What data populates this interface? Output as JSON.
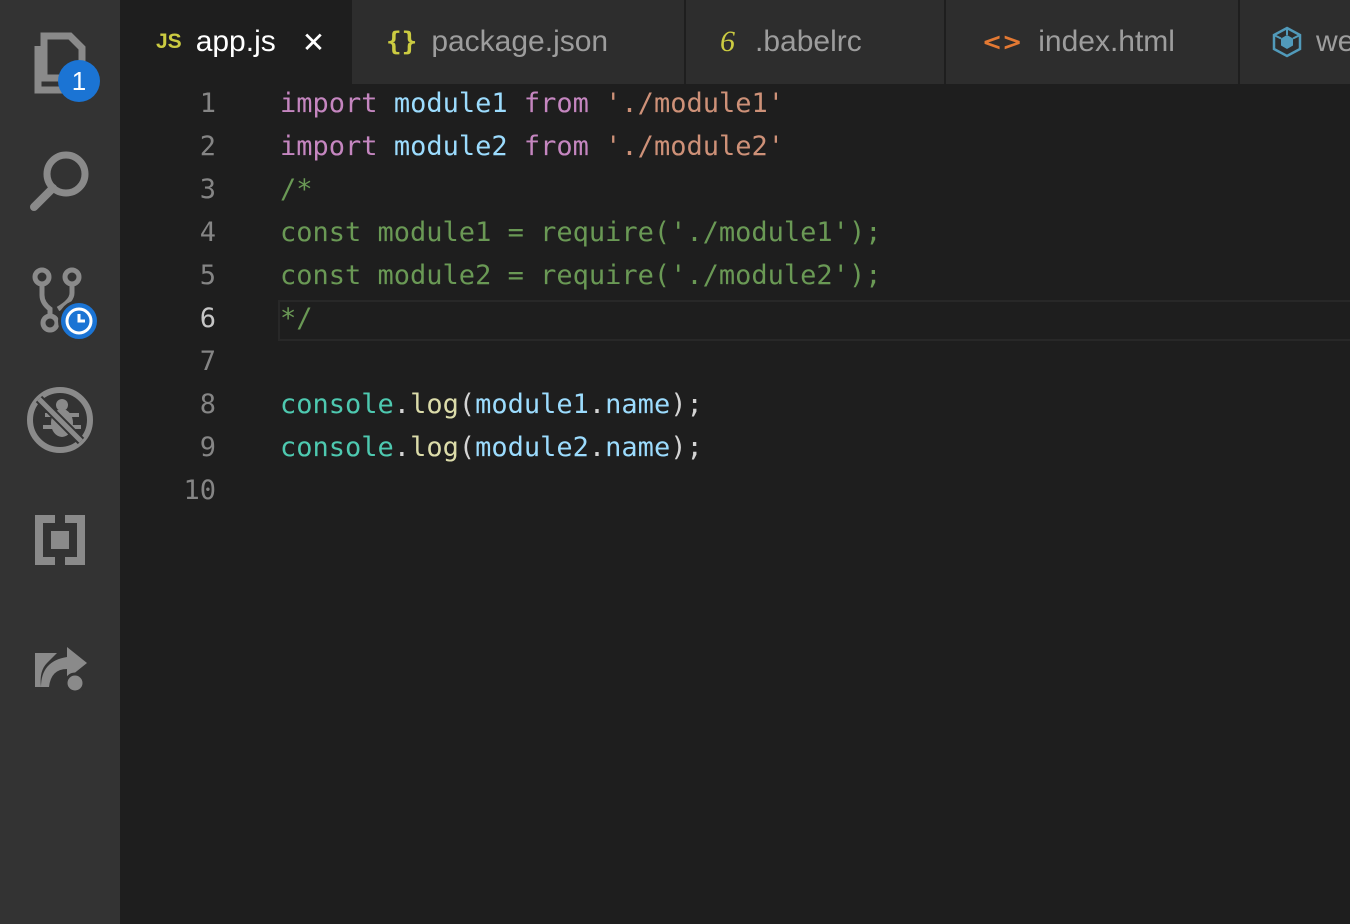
{
  "activity_bar": {
    "explorer_badge": "1",
    "items": [
      "explorer",
      "search",
      "source-control",
      "debug",
      "extensions",
      "live-share"
    ]
  },
  "tabs": [
    {
      "icon": "JS",
      "label": "app.js",
      "active": true,
      "close": "✕"
    },
    {
      "icon": "{}",
      "label": "package.json",
      "active": false
    },
    {
      "icon": "6",
      "label": ".babelrc",
      "active": false
    },
    {
      "icon": "<>",
      "label": "index.html",
      "active": false
    },
    {
      "icon": "webpack-cube-icon",
      "label": "we",
      "active": false
    }
  ],
  "editor": {
    "current_line": 6,
    "lines": [
      {
        "n": "1",
        "tokens": [
          [
            "kw",
            "import"
          ],
          [
            "pl",
            " "
          ],
          [
            "id",
            "module1"
          ],
          [
            "pl",
            " "
          ],
          [
            "kw",
            "from"
          ],
          [
            "pl",
            " "
          ],
          [
            "str",
            "'./module1'"
          ]
        ]
      },
      {
        "n": "2",
        "tokens": [
          [
            "kw",
            "import"
          ],
          [
            "pl",
            " "
          ],
          [
            "id",
            "module2"
          ],
          [
            "pl",
            " "
          ],
          [
            "kw",
            "from"
          ],
          [
            "pl",
            " "
          ],
          [
            "str",
            "'./module2'"
          ]
        ]
      },
      {
        "n": "3",
        "tokens": [
          [
            "cm",
            "/*"
          ]
        ]
      },
      {
        "n": "4",
        "tokens": [
          [
            "cm",
            "const module1 = require('./module1');"
          ]
        ]
      },
      {
        "n": "5",
        "tokens": [
          [
            "cm",
            "const module2 = require('./module2');"
          ]
        ]
      },
      {
        "n": "6",
        "tokens": [
          [
            "cm",
            "*/"
          ]
        ]
      },
      {
        "n": "7",
        "tokens": []
      },
      {
        "n": "8",
        "tokens": [
          [
            "ty",
            "console"
          ],
          [
            "pl",
            "."
          ],
          [
            "fn",
            "log"
          ],
          [
            "pl",
            "("
          ],
          [
            "id",
            "module1"
          ],
          [
            "pl",
            "."
          ],
          [
            "id",
            "name"
          ],
          [
            "pl",
            ");"
          ]
        ]
      },
      {
        "n": "9",
        "tokens": [
          [
            "ty",
            "console"
          ],
          [
            "pl",
            "."
          ],
          [
            "fn",
            "log"
          ],
          [
            "pl",
            "("
          ],
          [
            "id",
            "module2"
          ],
          [
            "pl",
            "."
          ],
          [
            "id",
            "name"
          ],
          [
            "pl",
            ");"
          ]
        ]
      },
      {
        "n": "10",
        "tokens": []
      }
    ]
  },
  "colors": {
    "keyword": "#c586c0",
    "identifier": "#9cdcfe",
    "string": "#ce9178",
    "comment": "#6a9955",
    "type": "#4ec9b0",
    "function": "#dcdcaa",
    "badge": "#1b74d4"
  }
}
